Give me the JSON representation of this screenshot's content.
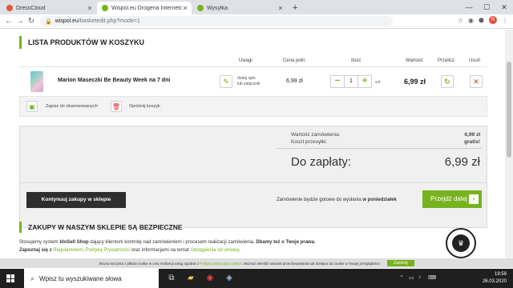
{
  "browser": {
    "tabs": [
      {
        "title": "DressCloud",
        "color": "#e8553e"
      },
      {
        "title": "Wispol.eu Drogeria Internetowa",
        "color": "#77b31f"
      },
      {
        "title": "Wysyłka",
        "color": "#77b31f"
      }
    ],
    "new_tab": "+",
    "url_host": "wispol.eu",
    "url_path": "/basketedit.php?mode=1"
  },
  "cart": {
    "title": "LISTA PRODUKTÓW W KOSZYKU",
    "columns": {
      "notes": "Uwagi",
      "unit_price": "Cena jedn.",
      "qty": "Ilość",
      "value": "Wartość",
      "recalc": "Przelicz",
      "remove": "Usuń"
    },
    "item": {
      "name": "Marion Maseczki Be Beauty Week na 7 dni",
      "note_line1": "dodaj opis",
      "note_line2": "lub załącznik",
      "unit_price": "6,99 zł",
      "qty": "1",
      "qty_unit": "szt.",
      "value": "6,99 zł"
    },
    "save_label": "Zapisz do obserwowanych",
    "empty_label": "Opróżnij koszyk"
  },
  "summary": {
    "order_value_label": "Wartość zamówienia:",
    "order_value": "6,99 zł",
    "shipping_label": "Koszt przesyłki:",
    "shipping_value": "gratis!",
    "total_label": "Do zapłaty:",
    "total_value": "6,99 zł",
    "continue_label": "Kontynuuj zakupy w sklepie",
    "ready_text": "Zamówienie będzie gotowe do wysłania",
    "ready_day": "w poniedziałek",
    "proceed_label": "Przejdź dalej",
    "accent": "#77b31f"
  },
  "safe": {
    "title": "ZAKUPY W NASZYM SKLEPIE SĄ BEZPIECZNE",
    "line1_a": "Stosujemy system",
    "line1_b": "IdoSell Shop",
    "line1_c": "dający klientom kontrolę nad zamówieniem i procesem realizacji zamówienia.",
    "line1_d": "Dbamy też o Twoje prawa",
    "line2_a": "Zapoznaj się z",
    "link_terms": "Regulaminem",
    "link_privacy": "Polityką Prywatności",
    "line2_b": "oraz informacjami na temat",
    "link_withdraw": "Odstąpienia od umowy"
  },
  "cookie": {
    "text_a": "Strona korzysta z plików cookie w celu realizacji usług zgodnie z",
    "link": "Polityką dotyczącą cookies",
    "text_b": "Możesz określić warunki przechowywania lub dostępu do cookie w Twojej przeglądarce.",
    "accept": "Zamknij"
  },
  "taskbar": {
    "search_placeholder": "Wpisz tu wyszukiwane słowa",
    "time": "19:59",
    "date": "26.03.2020"
  }
}
